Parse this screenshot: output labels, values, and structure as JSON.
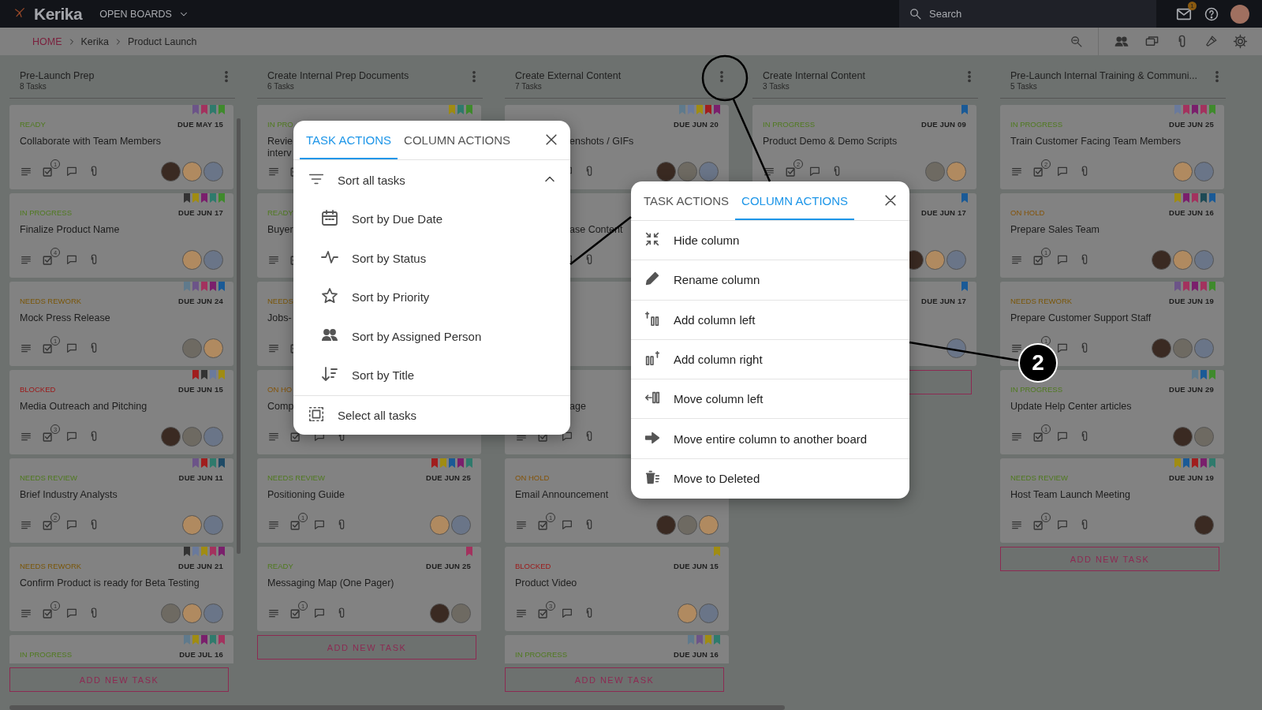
{
  "top_bar": {
    "logo": "Kerika",
    "boards_menu": "OPEN BOARDS",
    "search": {
      "placeholder": "Search"
    },
    "mail_badge": "1"
  },
  "breadcrumb": [
    "HOME",
    "Kerika",
    "Product Launch"
  ],
  "columns": [
    {
      "title": "Pre-Launch Prep",
      "task_count": "8 Tasks",
      "add_button": "ADD NEW TASK",
      "cards": [
        {
          "status": "READY",
          "kind": "ready",
          "due": "DUE MAY 15",
          "title": "Collaborate with Team Members",
          "checklist_count": "1",
          "flags": [
            {
              "color": "#6c5488"
            },
            {
              "color": "#a3325e"
            },
            {
              "color": "#2f7a6c"
            },
            {
              "color": "#3f8a2c"
            }
          ],
          "avatars": [
            {
              "color": "#3a2a22"
            },
            {
              "color": "#b08a60"
            },
            {
              "color": "#6a7588"
            }
          ]
        },
        {
          "status": "IN PROGRESS",
          "kind": "in_progress",
          "due": "DUE JUN 17",
          "title": "Finalize Product Name",
          "checklist_count": "4",
          "flags": [
            {
              "color": "#333333"
            },
            {
              "color": "#a08c12"
            },
            {
              "color": "#7a1f6c"
            },
            {
              "color": "#2f7a6c"
            },
            {
              "color": "#3f8a2c"
            }
          ],
          "avatars": [
            {
              "color": "#b08a60"
            },
            {
              "color": "#6a7588"
            }
          ]
        },
        {
          "status": "NEEDS REWORK",
          "kind": "needs_rework",
          "due": "DUE JUN 24",
          "title": "Mock Press Release",
          "checklist_count": "1",
          "flags": [
            {
              "color": "#5f7a8c"
            },
            {
              "color": "#6c5488"
            },
            {
              "color": "#a3325e"
            },
            {
              "color": "#7a1f6c"
            },
            {
              "color": "#1a5a96"
            }
          ],
          "avatars": [
            {
              "color": "#6e6a62"
            },
            {
              "color": "#b08a60"
            }
          ]
        },
        {
          "status": "BLOCKED",
          "kind": "blocked",
          "due": "DUE JUN 15",
          "title": "Media Outreach and Pitching",
          "checklist_count": "3",
          "flags": [
            {
              "color": "#a01e1e"
            },
            {
              "color": "#333333"
            },
            {
              "color": "#6a7a9c"
            },
            {
              "color": "#a08c12"
            }
          ],
          "avatars": [
            {
              "color": "#3a2a22"
            },
            {
              "color": "#6e6a62"
            },
            {
              "color": "#6a7588"
            }
          ]
        },
        {
          "status": "NEEDS REVIEW",
          "kind": "needs_review",
          "due": "DUE JUN 11",
          "title": "Brief Industry Analysts",
          "checklist_count": "2",
          "flags": [
            {
              "color": "#6c5488"
            },
            {
              "color": "#a01e1e"
            },
            {
              "color": "#2f7a6c"
            },
            {
              "color": "#1e4a66"
            }
          ],
          "avatars": [
            {
              "color": "#b08a60"
            },
            {
              "color": "#6a7588"
            }
          ]
        },
        {
          "status": "NEEDS REWORK",
          "kind": "needs_rework",
          "due": "DUE JUN 21",
          "title": "Confirm Product is ready for Beta Testing",
          "checklist_count": "1",
          "flags": [
            {
              "color": "#333333"
            },
            {
              "color": "#6a7a9c"
            },
            {
              "color": "#a08c12"
            },
            {
              "color": "#a3325e"
            },
            {
              "color": "#7a1f6c"
            }
          ],
          "avatars": [
            {
              "color": "#6e6a62"
            },
            {
              "color": "#b08a60"
            },
            {
              "color": "#6a7588"
            }
          ]
        },
        {
          "status": "IN PROGRESS",
          "kind": "in_progress",
          "due": "DUE JUL 16",
          "flags": [
            {
              "color": "#5f7a8c"
            },
            {
              "color": "#a08c12"
            },
            {
              "color": "#7a1f6c"
            },
            {
              "color": "#2f7a6c"
            },
            {
              "color": "#a3325e"
            }
          ]
        }
      ]
    },
    {
      "title": "Create Internal Prep Documents",
      "task_count": "6 Tasks",
      "add_button": "ADD NEW TASK",
      "cards": [
        {
          "status": "IN PRO",
          "kind": "in_progress",
          "title": "Revie\ninterv",
          "flags": [
            {
              "color": "#a08c12"
            },
            {
              "color": "#2f7a6c"
            },
            {
              "color": "#3f8a2c"
            }
          ]
        },
        {
          "status": "READY",
          "kind": "ready",
          "title": "Buyer"
        },
        {
          "status": "NEEDS",
          "kind": "needs_rework",
          "title": "Jobs-"
        },
        {
          "status": "ON HO",
          "kind": "on_hold",
          "title": "Comp"
        },
        {
          "status": "NEEDS REVIEW",
          "kind": "needs_review",
          "due": "DUE JUN 25",
          "title": "Positioning Guide",
          "checklist_count": "1",
          "flags": [
            {
              "color": "#a01e1e"
            },
            {
              "color": "#a08c12"
            },
            {
              "color": "#1a5a96"
            },
            {
              "color": "#7a1f6c"
            },
            {
              "color": "#2f7a6c"
            }
          ],
          "avatars": [
            {
              "color": "#b08a60"
            },
            {
              "color": "#6a7588"
            }
          ]
        },
        {
          "status": "READY",
          "kind": "ready",
          "due": "DUE JUN 25",
          "title": "Messaging Map (One Pager)",
          "checklist_count": "1",
          "flags": [
            {
              "color": "#a3325e"
            }
          ],
          "avatars": [
            {
              "color": "#3a2a22"
            },
            {
              "color": "#6e6a62"
            }
          ]
        }
      ]
    },
    {
      "title": "Create External Content",
      "task_count": "7 Tasks",
      "add_button": "ADD NEW TASK",
      "cards": [
        {
          "due": "DUE JUN 20",
          "title": "enshots / GIFs",
          "flags": [
            {
              "color": "#5f7a8c"
            },
            {
              "color": "#6a7a9c"
            },
            {
              "color": "#a08c12"
            },
            {
              "color": "#a01e1e"
            },
            {
              "color": "#7a1f6c"
            }
          ],
          "avatars": [
            {
              "color": "#3a2a22"
            },
            {
              "color": "#6e6a62"
            },
            {
              "color": "#6a7588"
            }
          ]
        },
        {
          "title": "ase Content"
        },
        {
          "kind": "covered"
        },
        {
          "title": "age"
        },
        {
          "status": "ON HOLD",
          "kind": "on_hold",
          "title": "Email Announcement",
          "checklist_count": "1",
          "avatars": [
            {
              "color": "#3a2a22"
            },
            {
              "color": "#6e6a62"
            },
            {
              "color": "#b08a60"
            }
          ]
        },
        {
          "status": "BLOCKED",
          "kind": "blocked",
          "due": "DUE JUN 15",
          "title": "Product Video",
          "checklist_count": "3",
          "flags": [
            {
              "color": "#a08c12"
            }
          ],
          "avatars": [
            {
              "color": "#b08a60"
            },
            {
              "color": "#6a7588"
            }
          ]
        },
        {
          "status": "IN PROGRESS",
          "kind": "in_progress",
          "due": "DUE JUN 16",
          "flags": [
            {
              "color": "#5f7a8c"
            },
            {
              "color": "#6c5488"
            },
            {
              "color": "#a08c12"
            },
            {
              "color": "#2f7a6c"
            }
          ]
        }
      ]
    },
    {
      "title": "Create Internal Content",
      "task_count": "3 Tasks",
      "cards": [
        {
          "status": "IN PROGRESS",
          "kind": "in_progress",
          "due": "DUE JUN 09",
          "title": "Product Demo & Demo Scripts",
          "checklist_count": "2",
          "flags": [
            {
              "color": "#1a5a96"
            }
          ],
          "avatars": [
            {
              "color": "#6e6a62"
            },
            {
              "color": "#b08a60"
            }
          ]
        },
        {
          "due": "DUE JUN 17",
          "flags": [
            {
              "color": "#1a5a96"
            }
          ],
          "avatars": [
            {
              "color": "#3a2a22"
            },
            {
              "color": "#b08a60"
            },
            {
              "color": "#6a7588"
            }
          ]
        },
        {
          "due": "DUE JUN 17",
          "flags": [
            {
              "color": "#1a5a96"
            }
          ],
          "avatars": [
            {
              "color": "#6a7588"
            }
          ]
        }
      ]
    },
    {
      "title": "Pre-Launch Internal Training & Communi...",
      "task_count": "5 Tasks",
      "add_button": "ADD NEW TASK",
      "cards": [
        {
          "status": "IN PROGRESS",
          "kind": "in_progress",
          "due": "DUE JUN 25",
          "title": "Train Customer Facing Team Members",
          "checklist_count": "2",
          "flags": [
            {
              "color": "#6a7a9c"
            },
            {
              "color": "#a3325e"
            },
            {
              "color": "#7a1f6c"
            },
            {
              "color": "#a3325e"
            },
            {
              "color": "#3f8a2c"
            }
          ],
          "avatars": [
            {
              "color": "#b08a60"
            },
            {
              "color": "#6a7588"
            }
          ]
        },
        {
          "status": "ON HOLD",
          "kind": "on_hold",
          "due": "DUE JUN 16",
          "title": "Prepare Sales Team",
          "checklist_count": "1",
          "flags": [
            {
              "color": "#a08c12"
            },
            {
              "color": "#7a1f6c"
            },
            {
              "color": "#a3325e"
            },
            {
              "color": "#1e4a55"
            },
            {
              "color": "#1a5a96"
            }
          ],
          "avatars": [
            {
              "color": "#3a2a22"
            },
            {
              "color": "#b08a60"
            },
            {
              "color": "#6a7588"
            }
          ]
        },
        {
          "status": "NEEDS REWORK",
          "kind": "needs_rework",
          "due": "DUE JUN 19",
          "title": "Prepare Customer Support Staff",
          "checklist_count": "1",
          "flags": [
            {
              "color": "#6c5488"
            },
            {
              "color": "#a3325e"
            },
            {
              "color": "#7a1f6c"
            },
            {
              "color": "#a3325e"
            },
            {
              "color": "#3f8a2c"
            }
          ],
          "avatars": [
            {
              "color": "#3a2a22"
            },
            {
              "color": "#6e6a62"
            },
            {
              "color": "#6a7588"
            }
          ]
        },
        {
          "status": "IN PROGRESS",
          "kind": "in_progress",
          "due": "DUE JUN 29",
          "title": "Update Help Center articles",
          "checklist_count": "1",
          "flags": [
            {
              "color": "#5f7a8c"
            },
            {
              "color": "#1a5a96"
            },
            {
              "color": "#3f8a2c"
            }
          ],
          "avatars": [
            {
              "color": "#3a2a22"
            },
            {
              "color": "#6e6a62"
            }
          ]
        },
        {
          "status": "NEEDS REVIEW",
          "kind": "needs_review",
          "due": "DUE JUN 19",
          "title": "Host Team Launch Meeting",
          "checklist_count": "1",
          "flags": [
            {
              "color": "#a08c12"
            },
            {
              "color": "#1a5a96"
            },
            {
              "color": "#a01e1e"
            },
            {
              "color": "#7a1f6c"
            },
            {
              "color": "#2f7a6c"
            }
          ],
          "avatars": [
            {
              "color": "#3a2a22"
            }
          ]
        }
      ]
    }
  ],
  "task_actions_popup": {
    "tabs": [
      {
        "label": "TASK ACTIONS",
        "selected": true
      },
      {
        "label": "COLUMN ACTIONS",
        "selected": false
      }
    ],
    "sort_group": {
      "label": "Sort all tasks",
      "expanded": true,
      "items": [
        {
          "kind": "due_date",
          "label": "Sort by Due Date"
        },
        {
          "kind": "status",
          "label": "Sort by Status"
        },
        {
          "kind": "priority",
          "label": "Sort by Priority"
        },
        {
          "kind": "person",
          "label": "Sort by Assigned Person"
        },
        {
          "kind": "title",
          "label": "Sort by Title"
        }
      ]
    },
    "select_all": "Select all tasks"
  },
  "column_actions_popup": {
    "tabs": [
      {
        "label": "TASK ACTIONS",
        "selected": false
      },
      {
        "label": "COLUMN ACTIONS",
        "selected": true
      }
    ],
    "items": [
      {
        "kind": "hide",
        "label": "Hide column"
      },
      {
        "kind": "rename",
        "label": "Rename column"
      },
      {
        "kind": "add_left",
        "label": "Add column left"
      },
      {
        "kind": "add_right",
        "label": "Add column right"
      },
      {
        "kind": "move_left",
        "label": "Move column left"
      },
      {
        "kind": "move_board",
        "label": "Move entire column to another board"
      },
      {
        "kind": "delete",
        "label": "Move to Deleted"
      }
    ]
  },
  "callout": {
    "label": "2"
  }
}
